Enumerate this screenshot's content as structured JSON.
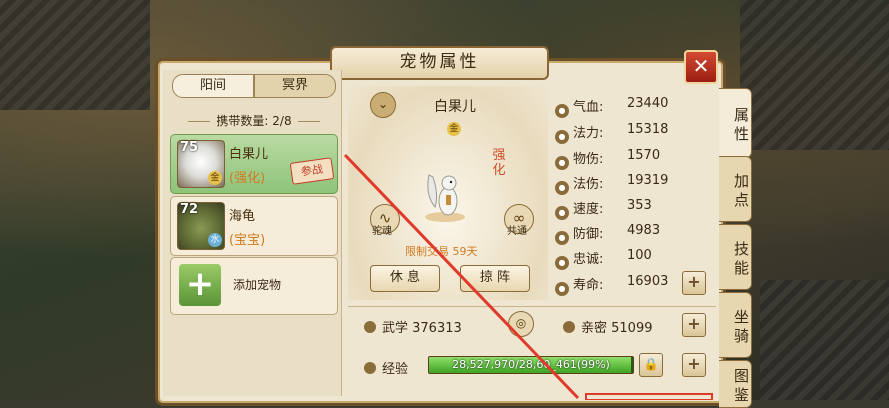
{
  "window": {
    "title": "宠物属性",
    "close": "✕"
  },
  "realm_tabs": [
    {
      "label": "阳间"
    },
    {
      "label": "冥界"
    }
  ],
  "carry": {
    "label": "携带数量: 2/8"
  },
  "pets": [
    {
      "level": "75",
      "name": "白果儿",
      "tag": "(强化)",
      "stamp": "参战",
      "grade_badge": "金"
    },
    {
      "level": "72",
      "name": "海龟",
      "tag": "(宝宝)",
      "grade_badge": "水"
    }
  ],
  "add_pet": {
    "icon": "+",
    "label": "添加宠物"
  },
  "detail": {
    "name": "白果儿",
    "grade_badge": "金",
    "upgrade_label": "强化",
    "skill_left": "驼魂",
    "skill_right": "共通",
    "limit_text": "限制交易 59天",
    "rest_button": "休 息",
    "formation_button": "掠 阵",
    "chevron_icon": "chevron-down-icon"
  },
  "stats": [
    {
      "label": "气血:",
      "value": "23440",
      "icon": "heart-icon"
    },
    {
      "label": "法力:",
      "value": "15318",
      "icon": "mana-icon"
    },
    {
      "label": "物伤:",
      "value": "1570",
      "icon": "sword-icon"
    },
    {
      "label": "法伤:",
      "value": "19319",
      "icon": "magic-icon"
    },
    {
      "label": "速度:",
      "value": "353",
      "icon": "speed-icon"
    },
    {
      "label": "防御:",
      "value": "4983",
      "icon": "shield-icon"
    },
    {
      "label": "忠诚:",
      "value": "100",
      "icon": "loyalty-icon"
    },
    {
      "label": "寿命:",
      "value": "16903",
      "icon": "life-icon"
    }
  ],
  "wuxue": {
    "label": "武学 376313"
  },
  "intimacy": {
    "label": "亲密 51099"
  },
  "exp": {
    "label": "经验",
    "text": "28,527,970/28,60_461(99%)",
    "progress": 0.99
  },
  "side_tabs": [
    {
      "label": "属性"
    },
    {
      "label": "加点"
    },
    {
      "label": "技能"
    },
    {
      "label": "坐骑"
    },
    {
      "label": "图鉴"
    }
  ],
  "colors": {
    "accent_green": "#8fc37a",
    "arrow_red": "#e03a2a",
    "panel_bg": "#efe6d1",
    "frame": "#6b4f2a"
  }
}
